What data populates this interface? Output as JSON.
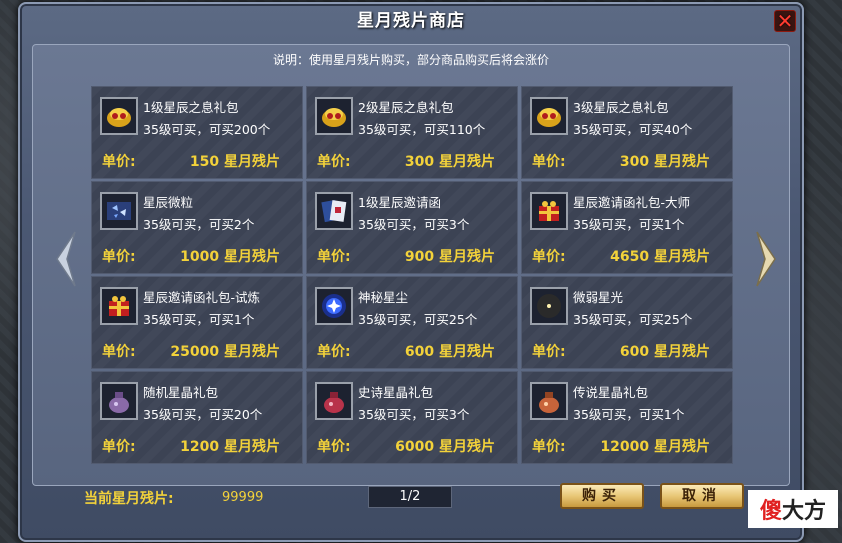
{
  "window": {
    "title": "星月残片商店",
    "close_symbol": "✕",
    "notice": "说明：使用星月残片购买，部分商品购买后将会涨价"
  },
  "items": [
    {
      "name": "1级星辰之息礼包",
      "avail": "35级可买，可买200个",
      "price_label": "单价:",
      "price": "150 星月残片",
      "icon": "gold-treasure-icon"
    },
    {
      "name": "2级星辰之息礼包",
      "avail": "35级可买，可买110个",
      "price_label": "单价:",
      "price": "300 星月残片",
      "icon": "gold-treasure-icon"
    },
    {
      "name": "3级星辰之息礼包",
      "avail": "35级可买，可买40个",
      "price_label": "单价:",
      "price": "300 星月残片",
      "icon": "gold-treasure-icon"
    },
    {
      "name": "星辰微粒",
      "avail": "35级可买，可买2个",
      "price_label": "单价:",
      "price": "1000 星月残片",
      "icon": "blue-crystal-icon"
    },
    {
      "name": "1级星辰邀请函",
      "avail": "35级可买，可买3个",
      "price_label": "单价:",
      "price": "900 星月残片",
      "icon": "invitation-scroll-icon"
    },
    {
      "name": "星辰邀请函礼包-大师",
      "avail": "35级可买，可买1个",
      "price_label": "单价:",
      "price": "4650 星月残片",
      "icon": "red-giftbox-icon"
    },
    {
      "name": "星辰邀请函礼包-试炼",
      "avail": "35级可买，可买1个",
      "price_label": "单价:",
      "price": "25000 星月残片",
      "icon": "red-giftbox-icon"
    },
    {
      "name": "神秘星尘",
      "avail": "35级可买，可买25个",
      "price_label": "单价:",
      "price": "600 星月残片",
      "icon": "blue-star-orb-icon"
    },
    {
      "name": "微弱星光",
      "avail": "35级可买，可买25个",
      "price_label": "单价:",
      "price": "600 星月残片",
      "icon": "gold-crescent-icon"
    },
    {
      "name": "随机星晶礼包",
      "avail": "35级可买，可买20个",
      "price_label": "单价:",
      "price": "1200 星月残片",
      "icon": "purple-pouch-icon"
    },
    {
      "name": "史诗星晶礼包",
      "avail": "35级可买，可买3个",
      "price_label": "单价:",
      "price": "6000 星月残片",
      "icon": "red-pouch-icon"
    },
    {
      "name": "传说星晶礼包",
      "avail": "35级可买，可买1个",
      "price_label": "单价:",
      "price": "12000 星月残片",
      "icon": "orange-pouch-icon"
    }
  ],
  "footer": {
    "balance_label": "当前星月残片:",
    "balance_value": "99999",
    "page": "1/2",
    "buy_label": "购买",
    "cancel_label": "取消"
  },
  "watermark": {
    "part1": "傻",
    "part2": "大方"
  },
  "colors": {
    "accent_gold": "#f3d23a",
    "close_red": "#ff3b30",
    "panel": "#3d4456"
  }
}
